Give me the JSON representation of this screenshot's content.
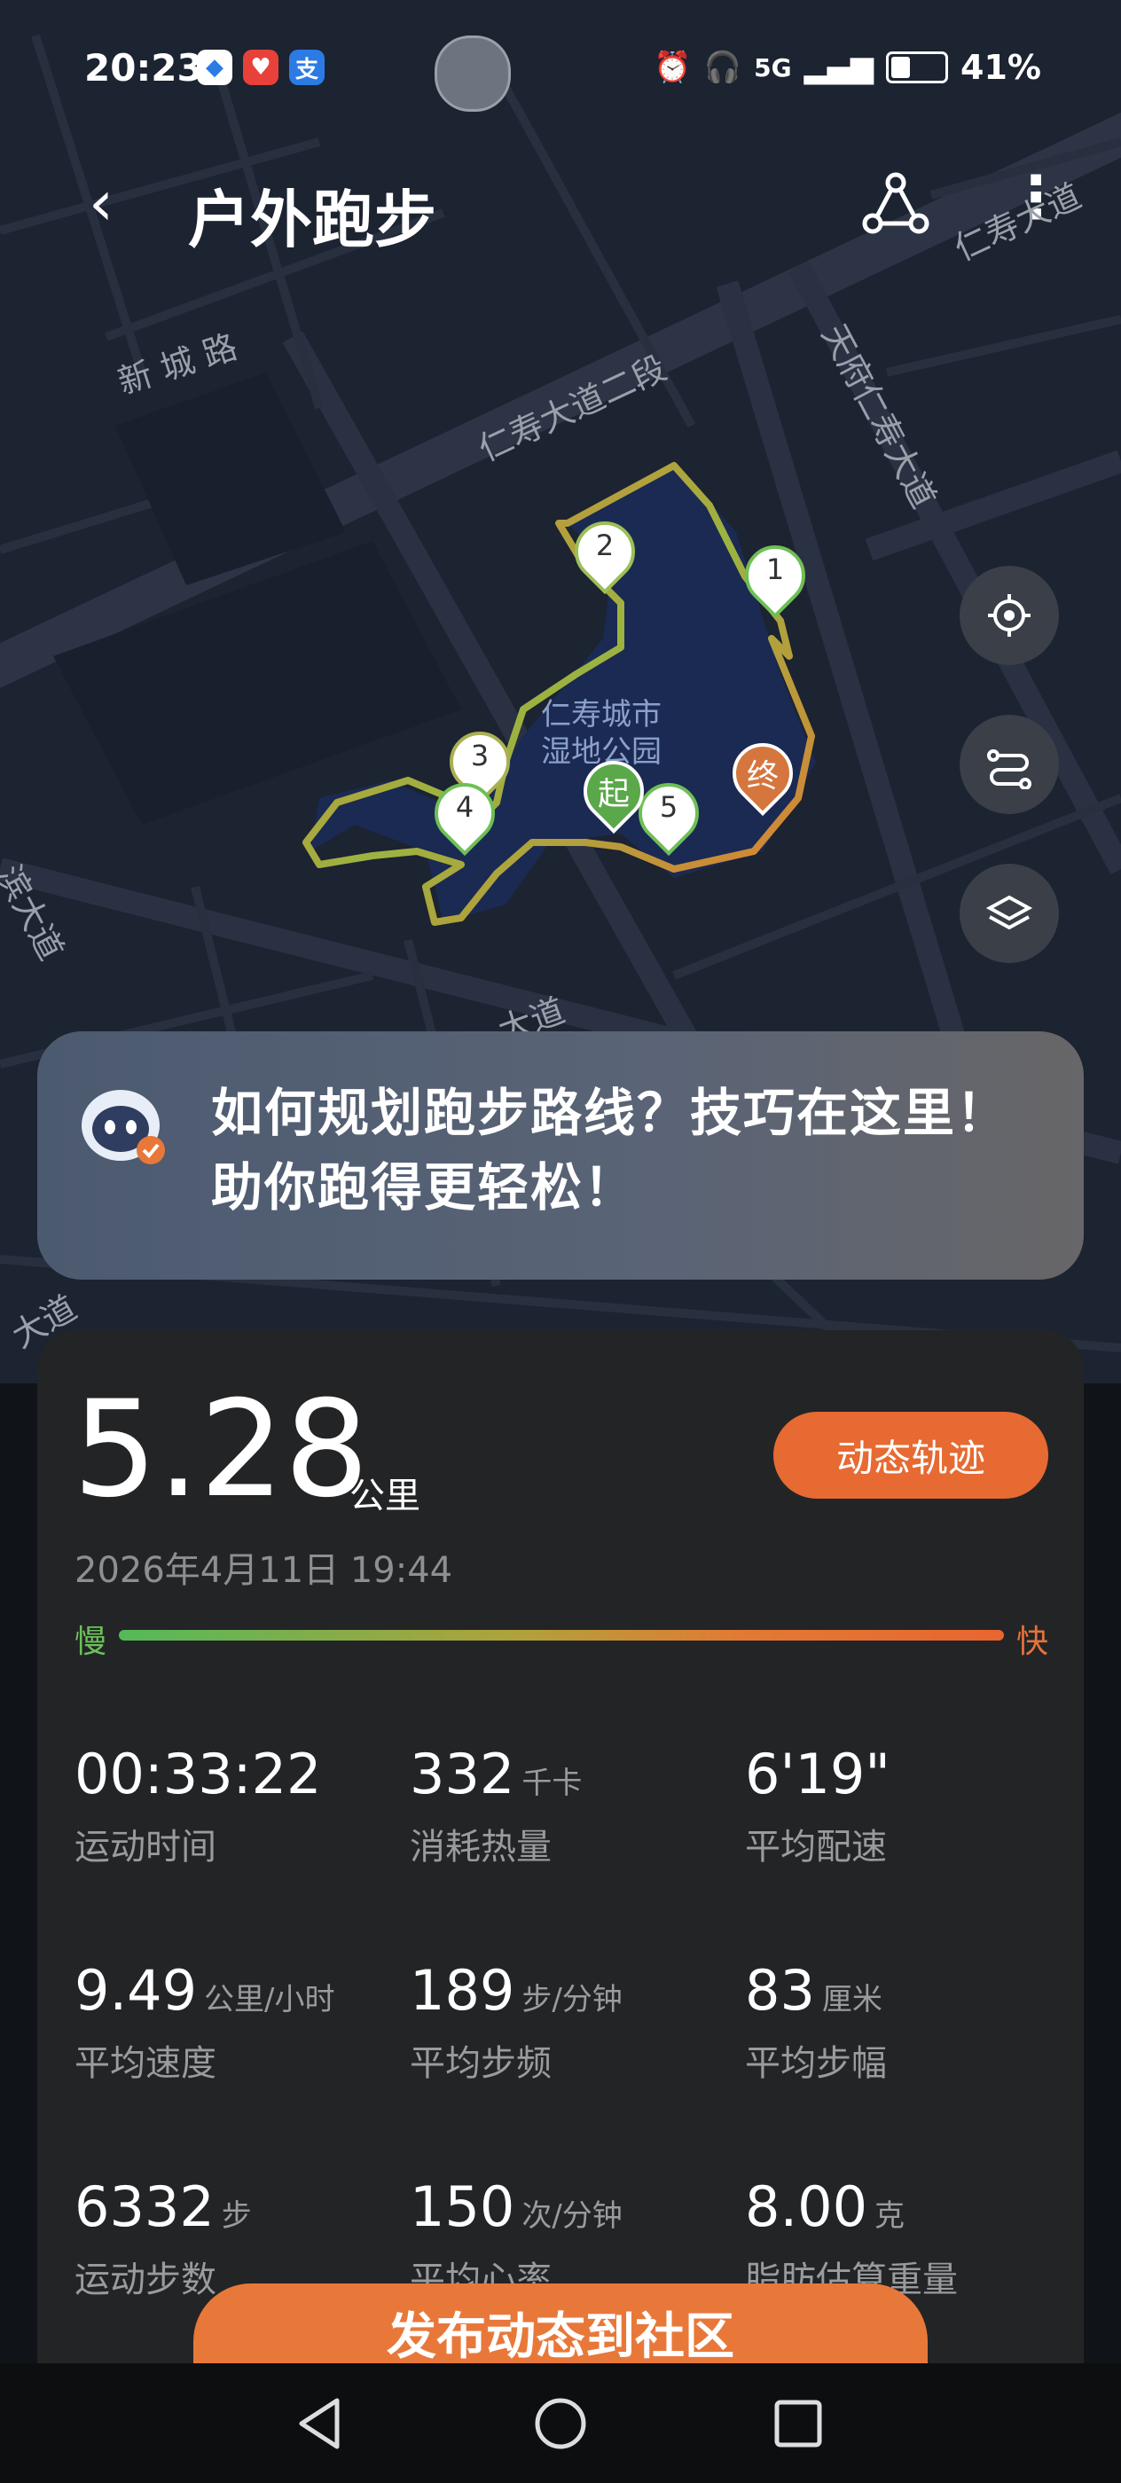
{
  "status_bar": {
    "time": "20:23",
    "apps": [
      {
        "icon": "colorful-app-icon",
        "label": "",
        "color": "#ffffff"
      },
      {
        "icon": "heart-app-icon",
        "label": "",
        "color": "#e8413a"
      },
      {
        "icon": "alipay-icon",
        "label": "支",
        "color": "#2c7be5"
      }
    ],
    "signal_label": "5G",
    "battery_percent": "41%",
    "battery_level": 0.41
  },
  "header": {
    "title": "户外跑步",
    "back_icon": "chevron-left-icon",
    "share_icon": "route-share-icon",
    "more_icon": "more-vertical-icon"
  },
  "map": {
    "roads": [
      "新 城 路",
      "仁寿大道二段",
      "天府仁寿大道",
      "仁寿大道",
      "滨大道",
      "大道",
      "大道"
    ],
    "park_name": [
      "仁寿城市",
      "湿地公园"
    ],
    "markers": [
      "1",
      "2",
      "3",
      "4",
      "5"
    ],
    "start_label": "起",
    "end_label": "终",
    "buttons": [
      "locate-icon",
      "route-switch-icon",
      "layers-icon"
    ]
  },
  "banner": {
    "line1": "如何规划跑步路线？技巧在这里！",
    "line2": "助你跑得更轻松！"
  },
  "summary": {
    "distance": "5.28",
    "distance_unit": "公里",
    "dynamic_track_label": "动态轨迹",
    "date": "2026年4月11日 19:44",
    "slow_label": "慢",
    "fast_label": "快"
  },
  "stats": [
    {
      "value": "00:33:22",
      "unit": "",
      "label": "运动时间"
    },
    {
      "value": "332",
      "unit": "千卡",
      "label": "消耗热量"
    },
    {
      "value": "6'19\"",
      "unit": "",
      "label": "平均配速"
    },
    {
      "value": "9.49",
      "unit": "公里/小时",
      "label": "平均速度"
    },
    {
      "value": "189",
      "unit": "步/分钟",
      "label": "平均步频"
    },
    {
      "value": "83",
      "unit": "厘米",
      "label": "平均步幅"
    },
    {
      "value": "6332",
      "unit": "步",
      "label": "运动步数"
    },
    {
      "value": "150",
      "unit": "次/分钟",
      "label": "平均心率"
    },
    {
      "value": "8.00",
      "unit": "克",
      "label": "脂肪估算重量"
    }
  ],
  "publish_label": "发布动态到社区",
  "nav": [
    "back-triangle-icon",
    "home-circle-icon",
    "recents-square-icon"
  ],
  "colors": {
    "accent": "#e66a32",
    "slow": "#54b95a",
    "card": "#232426"
  }
}
